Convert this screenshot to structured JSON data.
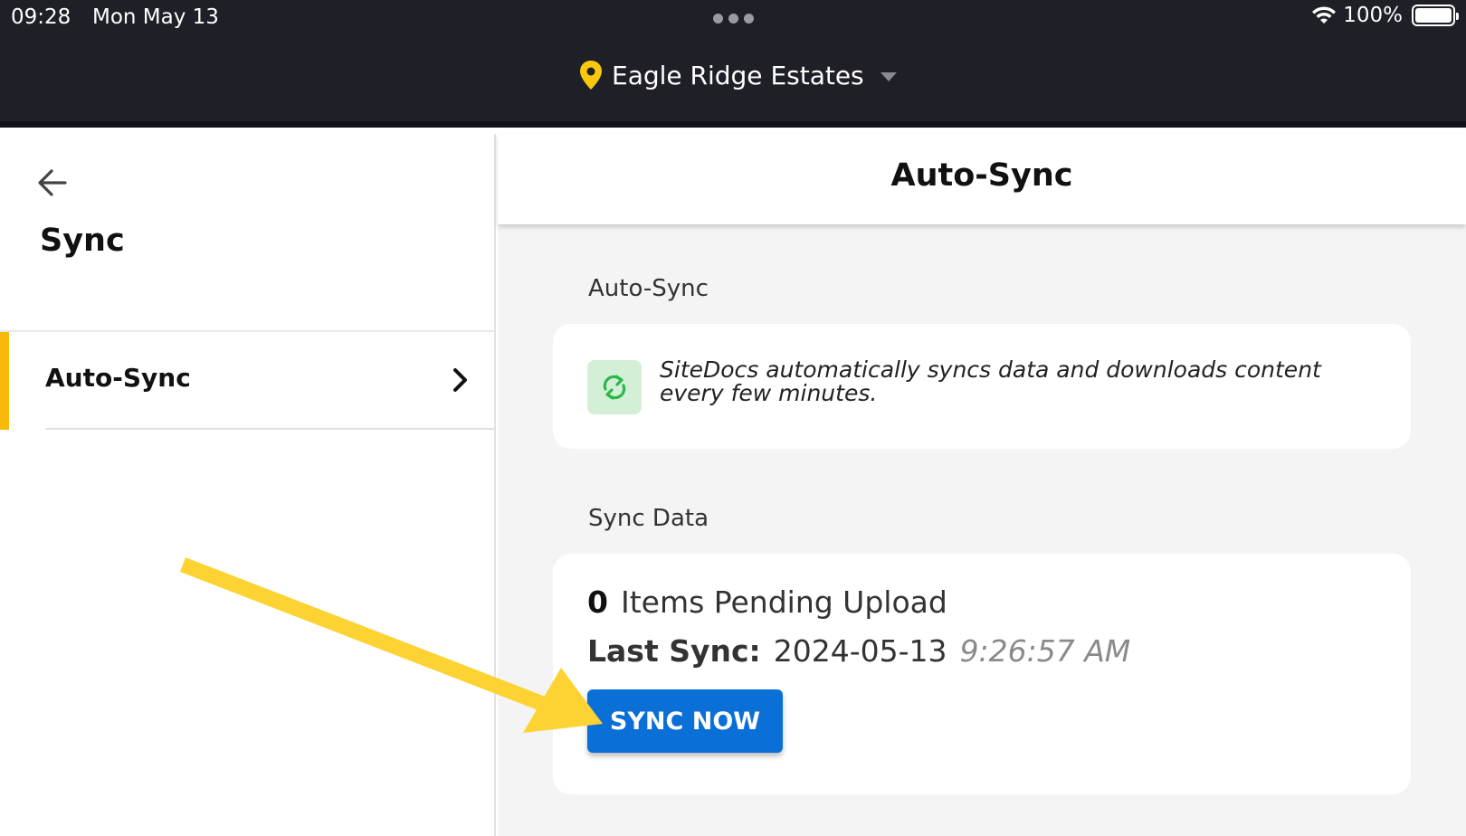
{
  "status_bar": {
    "time": "09:28",
    "date": "Mon May 13",
    "battery": "100%"
  },
  "header": {
    "location": "Eagle Ridge Estates"
  },
  "left_panel": {
    "title": "Sync",
    "items": [
      {
        "label": "Auto-Sync",
        "active": true
      }
    ]
  },
  "main": {
    "title": "Auto-Sync",
    "auto_sync_section": {
      "label": "Auto-Sync",
      "description": "SiteDocs automatically syncs data and downloads content every few minutes."
    },
    "sync_data_section": {
      "label": "Sync Data",
      "pending_count": "0",
      "pending_text": "Items Pending Upload",
      "last_sync_label": "Last Sync:",
      "last_sync_date": "2024-05-13",
      "last_sync_time": "9:26:57 AM",
      "button_label": "SYNC NOW"
    }
  },
  "colors": {
    "accent_yellow": "#f9b90a",
    "button_blue": "#0a6fd6",
    "sync_green": "#2db84c",
    "annotation_arrow": "#fdd334"
  },
  "icons": [
    "wifi-icon",
    "battery-icon",
    "pin-icon",
    "caret-down-icon",
    "back-arrow-icon",
    "chevron-right-icon",
    "sync-icon",
    "annotation-arrow"
  ]
}
